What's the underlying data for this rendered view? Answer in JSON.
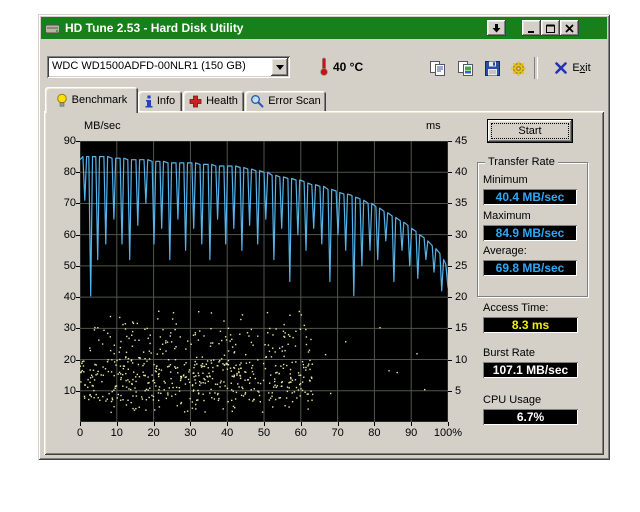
{
  "window": {
    "title": "HD Tune 2.53 - Hard Disk Utility"
  },
  "toolbar": {
    "drive_selector_value": "WDC WD1500ADFD-00NLR1 (150 GB)",
    "temperature": "40 °C",
    "exit_label": {
      "pre": "E",
      "underlined": "x",
      "post": "it"
    }
  },
  "tabs": [
    {
      "label": "Benchmark",
      "active": true
    },
    {
      "label": "Info",
      "active": false
    },
    {
      "label": "Health",
      "active": false
    },
    {
      "label": "Error Scan",
      "active": false
    }
  ],
  "benchmark": {
    "start_button": "Start",
    "transfer_rate": {
      "legend": "Transfer Rate",
      "minimum_label": "Minimum",
      "minimum_value": "40.4 MB/sec",
      "maximum_label": "Maximum",
      "maximum_value": "84.9 MB/sec",
      "average_label": "Average:",
      "average_value": "69.8 MB/sec"
    },
    "access_time_label": "Access Time:",
    "access_time_value": "8.3 ms",
    "burst_rate_label": "Burst Rate",
    "burst_rate_value": "107.1 MB/sec",
    "cpu_usage_label": "CPU Usage",
    "cpu_usage_value": "6.7%"
  },
  "chart_data": {
    "type": "line+scatter",
    "ylabel_left": "MB/sec",
    "ylabel_right": "ms",
    "ylim_left": [
      0,
      90
    ],
    "ylim_right": [
      0,
      45
    ],
    "xlim": [
      0,
      100
    ],
    "yticks_left": [
      90,
      80,
      70,
      60,
      50,
      40,
      30,
      20,
      10
    ],
    "yticks_right": [
      45,
      40,
      35,
      30,
      25,
      20,
      15,
      10,
      5
    ],
    "xtick_labels": [
      "0",
      "10",
      "20",
      "30",
      "40",
      "50",
      "60",
      "70",
      "80",
      "90",
      "100%"
    ],
    "grid": true,
    "bg_color": "#000000",
    "grid_color": "#4d564d",
    "series": [
      {
        "name": "transfer_rate_line",
        "type": "line",
        "color": "#55b4ec",
        "points": [
          [
            0,
            84
          ],
          [
            0.8,
            85
          ],
          [
            1.3,
            71
          ],
          [
            1.8,
            85
          ],
          [
            2.4,
            85
          ],
          [
            2.9,
            40.4
          ],
          [
            3.4,
            85
          ],
          [
            4.3,
            85
          ],
          [
            4.8,
            52
          ],
          [
            5.3,
            85
          ],
          [
            6.5,
            85
          ],
          [
            7.0,
            57
          ],
          [
            7.5,
            85
          ],
          [
            8.7,
            84.5
          ],
          [
            9.2,
            65
          ],
          [
            9.7,
            84.5
          ],
          [
            10.9,
            84.5
          ],
          [
            11.4,
            57
          ],
          [
            11.9,
            84.5
          ],
          [
            13.0,
            84
          ],
          [
            13.5,
            52
          ],
          [
            14.0,
            84
          ],
          [
            15.2,
            84
          ],
          [
            15.7,
            63
          ],
          [
            16.2,
            84
          ],
          [
            17.4,
            84
          ],
          [
            17.9,
            70
          ],
          [
            18.4,
            84
          ],
          [
            19.6,
            83.5
          ],
          [
            20.1,
            57
          ],
          [
            20.6,
            83.5
          ],
          [
            21.7,
            83.5
          ],
          [
            22.2,
            62
          ],
          [
            22.7,
            83.5
          ],
          [
            23.9,
            83
          ],
          [
            24.4,
            52
          ],
          [
            24.9,
            83
          ],
          [
            26.1,
            83
          ],
          [
            26.6,
            65
          ],
          [
            27.1,
            83
          ],
          [
            28.2,
            83
          ],
          [
            28.7,
            55
          ],
          [
            29.2,
            83
          ],
          [
            30.4,
            83
          ],
          [
            30.9,
            62
          ],
          [
            31.4,
            83
          ],
          [
            32.6,
            82.5
          ],
          [
            33.1,
            57
          ],
          [
            33.6,
            82.5
          ],
          [
            34.8,
            82.5
          ],
          [
            35.3,
            52
          ],
          [
            35.8,
            82.5
          ],
          [
            36.9,
            82
          ],
          [
            37.4,
            65
          ],
          [
            37.9,
            82
          ],
          [
            39.1,
            82
          ],
          [
            39.6,
            57
          ],
          [
            40.1,
            82
          ],
          [
            41.3,
            82
          ],
          [
            41.8,
            62
          ],
          [
            42.3,
            82
          ],
          [
            43.5,
            81.5
          ],
          [
            44.0,
            55
          ],
          [
            44.5,
            81.5
          ],
          [
            45.6,
            81
          ],
          [
            46.1,
            63
          ],
          [
            46.6,
            81
          ],
          [
            47.8,
            80.5
          ],
          [
            48.3,
            57
          ],
          [
            48.8,
            80.5
          ],
          [
            50.0,
            80
          ],
          [
            50.5,
            65
          ],
          [
            51.0,
            80
          ],
          [
            52.2,
            79
          ],
          [
            52.7,
            52
          ],
          [
            53.2,
            79
          ],
          [
            54.3,
            78.5
          ],
          [
            54.8,
            62
          ],
          [
            55.3,
            78.5
          ],
          [
            56.5,
            78
          ],
          [
            57.0,
            45
          ],
          [
            57.5,
            78
          ],
          [
            58.7,
            77.5
          ],
          [
            59.2,
            60
          ],
          [
            59.7,
            77.5
          ],
          [
            60.9,
            77
          ],
          [
            61.4,
            55
          ],
          [
            61.9,
            76.5
          ],
          [
            63.0,
            76
          ],
          [
            63.5,
            62
          ],
          [
            64.0,
            76
          ],
          [
            65.2,
            75.5
          ],
          [
            65.7,
            57
          ],
          [
            66.2,
            75.5
          ],
          [
            67.4,
            74.5
          ],
          [
            67.9,
            45
          ],
          [
            68.4,
            74.5
          ],
          [
            69.6,
            74
          ],
          [
            70.1,
            60
          ],
          [
            70.6,
            73.5
          ],
          [
            71.7,
            73
          ],
          [
            72.2,
            55
          ],
          [
            72.7,
            73
          ],
          [
            73.9,
            72.5
          ],
          [
            74.4,
            40.5
          ],
          [
            74.9,
            72
          ],
          [
            76.1,
            71.5
          ],
          [
            76.6,
            50
          ],
          [
            77.1,
            71
          ],
          [
            78.3,
            70
          ],
          [
            78.8,
            55
          ],
          [
            79.3,
            70
          ],
          [
            80.4,
            69
          ],
          [
            80.9,
            52
          ],
          [
            81.4,
            68.5
          ],
          [
            82.6,
            67.5
          ],
          [
            83.1,
            58
          ],
          [
            83.6,
            67
          ],
          [
            84.8,
            66
          ],
          [
            85.3,
            45
          ],
          [
            85.8,
            65.5
          ],
          [
            87.0,
            64.5
          ],
          [
            87.5,
            55
          ],
          [
            88.0,
            64
          ],
          [
            89.1,
            63
          ],
          [
            89.6,
            50
          ],
          [
            90.1,
            62
          ],
          [
            91.3,
            61
          ],
          [
            91.8,
            46
          ],
          [
            92.3,
            60
          ],
          [
            93.5,
            59
          ],
          [
            94.0,
            52
          ],
          [
            94.5,
            58
          ],
          [
            95.7,
            56.5
          ],
          [
            96.2,
            48
          ],
          [
            96.7,
            55.5
          ],
          [
            97.8,
            54
          ],
          [
            98.3,
            42
          ],
          [
            98.8,
            52
          ],
          [
            99.4,
            50.5
          ],
          [
            100,
            43
          ]
        ]
      },
      {
        "name": "access_time_dots",
        "type": "scatter",
        "color": "#eceaa0",
        "seed": 42,
        "clusters": [
          {
            "count": 420,
            "x": [
              0,
              63.5
            ],
            "y": [
              6.5,
              20
            ]
          },
          {
            "count": 130,
            "x": [
              0,
              63.5
            ],
            "y": [
              20,
              30
            ]
          },
          {
            "count": 25,
            "x": [
              0,
              63.5
            ],
            "y": [
              30,
              36
            ]
          },
          {
            "count": 30,
            "x": [
              0,
              63.5
            ],
            "y": [
              3,
              6.5
            ]
          },
          {
            "count": 8,
            "x": [
              63.5,
              100
            ],
            "y": [
              3,
              36
            ]
          }
        ]
      }
    ]
  }
}
